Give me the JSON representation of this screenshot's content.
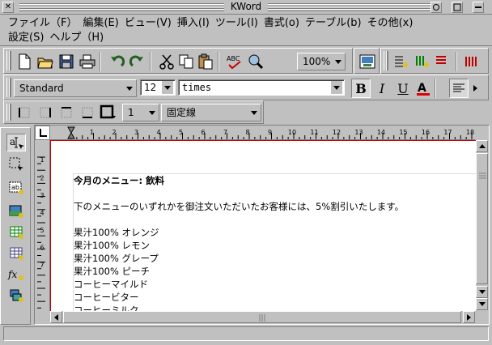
{
  "window": {
    "title": "KWord"
  },
  "menu": {
    "row1": [
      "ファイル（F）",
      "編集(E)",
      "ビュー(V)",
      "挿入(I)",
      "ツール(I)",
      "書式(o)",
      "テーブル(b)",
      "その他(x)"
    ],
    "row2": [
      "設定(S)",
      "ヘルプ（H)"
    ]
  },
  "toolbar": {
    "zoom": "100%",
    "style": "Standard",
    "font_size": "12",
    "font_family": "times",
    "bold": "B",
    "italic": "I",
    "underline": "U",
    "border_width": "1",
    "border_style": "固定線"
  },
  "ruler": {
    "h_ticks": [
      "1",
      "2",
      "3",
      "4",
      "5",
      "6",
      "7",
      "8",
      "9",
      "10",
      "11",
      "12",
      "13",
      "14",
      "15",
      "16",
      "17",
      "18"
    ],
    "v_ticks": [
      "1",
      "2",
      "3",
      "4",
      "5",
      "6",
      "7"
    ]
  },
  "document": {
    "heading": "今月のメニュー: 飲料",
    "intro": "下のメニューのいずれかを御注文いただいたお客様には、5%割引いたします。",
    "items": [
      "果汁100% オレンジ",
      "果汁100% レモン",
      "果汁100% グレープ",
      "果汁100% ピーチ",
      "コーヒーマイルド",
      "コーヒービター",
      "コーヒーミルク"
    ]
  },
  "colors": {
    "page_border": "#cc0000",
    "chrome": "#c0c0c0"
  }
}
